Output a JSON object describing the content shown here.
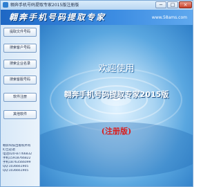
{
  "window": {
    "title": "翱奔手机号码提取专家2015版注册版",
    "minimize": "−",
    "maximize": "□",
    "close": "×"
  },
  "banner": {
    "title": "翱奔手机号码提取专家",
    "url": "www.58ams.com"
  },
  "sidebar": {
    "buttons": [
      "提取文件号码",
      "搜索客户号码",
      "搜索企业名录",
      "搜索客服号码",
      "软件注册",
      "其他软件"
    ],
    "info": [
      "翱奔科技出版权所有",
      "盯告必退",
      "",
      "电话020-87766832",
      "手机15918766822",
      "手机18763566099",
      "QQ:1036661905",
      "QQ:1036661905"
    ]
  },
  "main": {
    "welcome": "欢迎使用",
    "product": "翱奔手机号码提取专家2015版",
    "edition": "(注册版)"
  }
}
